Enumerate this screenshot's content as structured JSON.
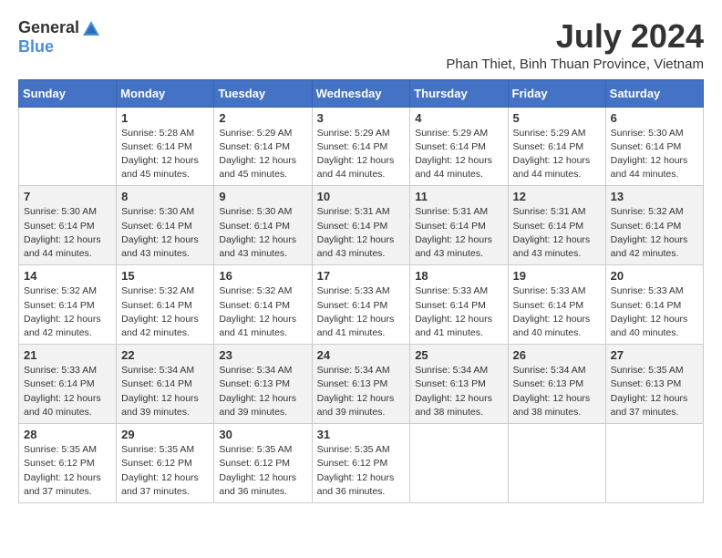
{
  "logo": {
    "text_general": "General",
    "text_blue": "Blue"
  },
  "title": {
    "month_year": "July 2024",
    "location": "Phan Thiet, Binh Thuan Province, Vietnam"
  },
  "days_of_week": [
    "Sunday",
    "Monday",
    "Tuesday",
    "Wednesday",
    "Thursday",
    "Friday",
    "Saturday"
  ],
  "weeks": [
    [
      {
        "day": "",
        "info": ""
      },
      {
        "day": "1",
        "info": "Sunrise: 5:28 AM\nSunset: 6:14 PM\nDaylight: 12 hours and 45 minutes."
      },
      {
        "day": "2",
        "info": "Sunrise: 5:29 AM\nSunset: 6:14 PM\nDaylight: 12 hours and 45 minutes."
      },
      {
        "day": "3",
        "info": "Sunrise: 5:29 AM\nSunset: 6:14 PM\nDaylight: 12 hours and 44 minutes."
      },
      {
        "day": "4",
        "info": "Sunrise: 5:29 AM\nSunset: 6:14 PM\nDaylight: 12 hours and 44 minutes."
      },
      {
        "day": "5",
        "info": "Sunrise: 5:29 AM\nSunset: 6:14 PM\nDaylight: 12 hours and 44 minutes."
      },
      {
        "day": "6",
        "info": "Sunrise: 5:30 AM\nSunset: 6:14 PM\nDaylight: 12 hours and 44 minutes."
      }
    ],
    [
      {
        "day": "7",
        "info": "Sunrise: 5:30 AM\nSunset: 6:14 PM\nDaylight: 12 hours and 44 minutes."
      },
      {
        "day": "8",
        "info": "Sunrise: 5:30 AM\nSunset: 6:14 PM\nDaylight: 12 hours and 43 minutes."
      },
      {
        "day": "9",
        "info": "Sunrise: 5:30 AM\nSunset: 6:14 PM\nDaylight: 12 hours and 43 minutes."
      },
      {
        "day": "10",
        "info": "Sunrise: 5:31 AM\nSunset: 6:14 PM\nDaylight: 12 hours and 43 minutes."
      },
      {
        "day": "11",
        "info": "Sunrise: 5:31 AM\nSunset: 6:14 PM\nDaylight: 12 hours and 43 minutes."
      },
      {
        "day": "12",
        "info": "Sunrise: 5:31 AM\nSunset: 6:14 PM\nDaylight: 12 hours and 43 minutes."
      },
      {
        "day": "13",
        "info": "Sunrise: 5:32 AM\nSunset: 6:14 PM\nDaylight: 12 hours and 42 minutes."
      }
    ],
    [
      {
        "day": "14",
        "info": "Sunrise: 5:32 AM\nSunset: 6:14 PM\nDaylight: 12 hours and 42 minutes."
      },
      {
        "day": "15",
        "info": "Sunrise: 5:32 AM\nSunset: 6:14 PM\nDaylight: 12 hours and 42 minutes."
      },
      {
        "day": "16",
        "info": "Sunrise: 5:32 AM\nSunset: 6:14 PM\nDaylight: 12 hours and 41 minutes."
      },
      {
        "day": "17",
        "info": "Sunrise: 5:33 AM\nSunset: 6:14 PM\nDaylight: 12 hours and 41 minutes."
      },
      {
        "day": "18",
        "info": "Sunrise: 5:33 AM\nSunset: 6:14 PM\nDaylight: 12 hours and 41 minutes."
      },
      {
        "day": "19",
        "info": "Sunrise: 5:33 AM\nSunset: 6:14 PM\nDaylight: 12 hours and 40 minutes."
      },
      {
        "day": "20",
        "info": "Sunrise: 5:33 AM\nSunset: 6:14 PM\nDaylight: 12 hours and 40 minutes."
      }
    ],
    [
      {
        "day": "21",
        "info": "Sunrise: 5:33 AM\nSunset: 6:14 PM\nDaylight: 12 hours and 40 minutes."
      },
      {
        "day": "22",
        "info": "Sunrise: 5:34 AM\nSunset: 6:14 PM\nDaylight: 12 hours and 39 minutes."
      },
      {
        "day": "23",
        "info": "Sunrise: 5:34 AM\nSunset: 6:13 PM\nDaylight: 12 hours and 39 minutes."
      },
      {
        "day": "24",
        "info": "Sunrise: 5:34 AM\nSunset: 6:13 PM\nDaylight: 12 hours and 39 minutes."
      },
      {
        "day": "25",
        "info": "Sunrise: 5:34 AM\nSunset: 6:13 PM\nDaylight: 12 hours and 38 minutes."
      },
      {
        "day": "26",
        "info": "Sunrise: 5:34 AM\nSunset: 6:13 PM\nDaylight: 12 hours and 38 minutes."
      },
      {
        "day": "27",
        "info": "Sunrise: 5:35 AM\nSunset: 6:13 PM\nDaylight: 12 hours and 37 minutes."
      }
    ],
    [
      {
        "day": "28",
        "info": "Sunrise: 5:35 AM\nSunset: 6:12 PM\nDaylight: 12 hours and 37 minutes."
      },
      {
        "day": "29",
        "info": "Sunrise: 5:35 AM\nSunset: 6:12 PM\nDaylight: 12 hours and 37 minutes."
      },
      {
        "day": "30",
        "info": "Sunrise: 5:35 AM\nSunset: 6:12 PM\nDaylight: 12 hours and 36 minutes."
      },
      {
        "day": "31",
        "info": "Sunrise: 5:35 AM\nSunset: 6:12 PM\nDaylight: 12 hours and 36 minutes."
      },
      {
        "day": "",
        "info": ""
      },
      {
        "day": "",
        "info": ""
      },
      {
        "day": "",
        "info": ""
      }
    ]
  ]
}
